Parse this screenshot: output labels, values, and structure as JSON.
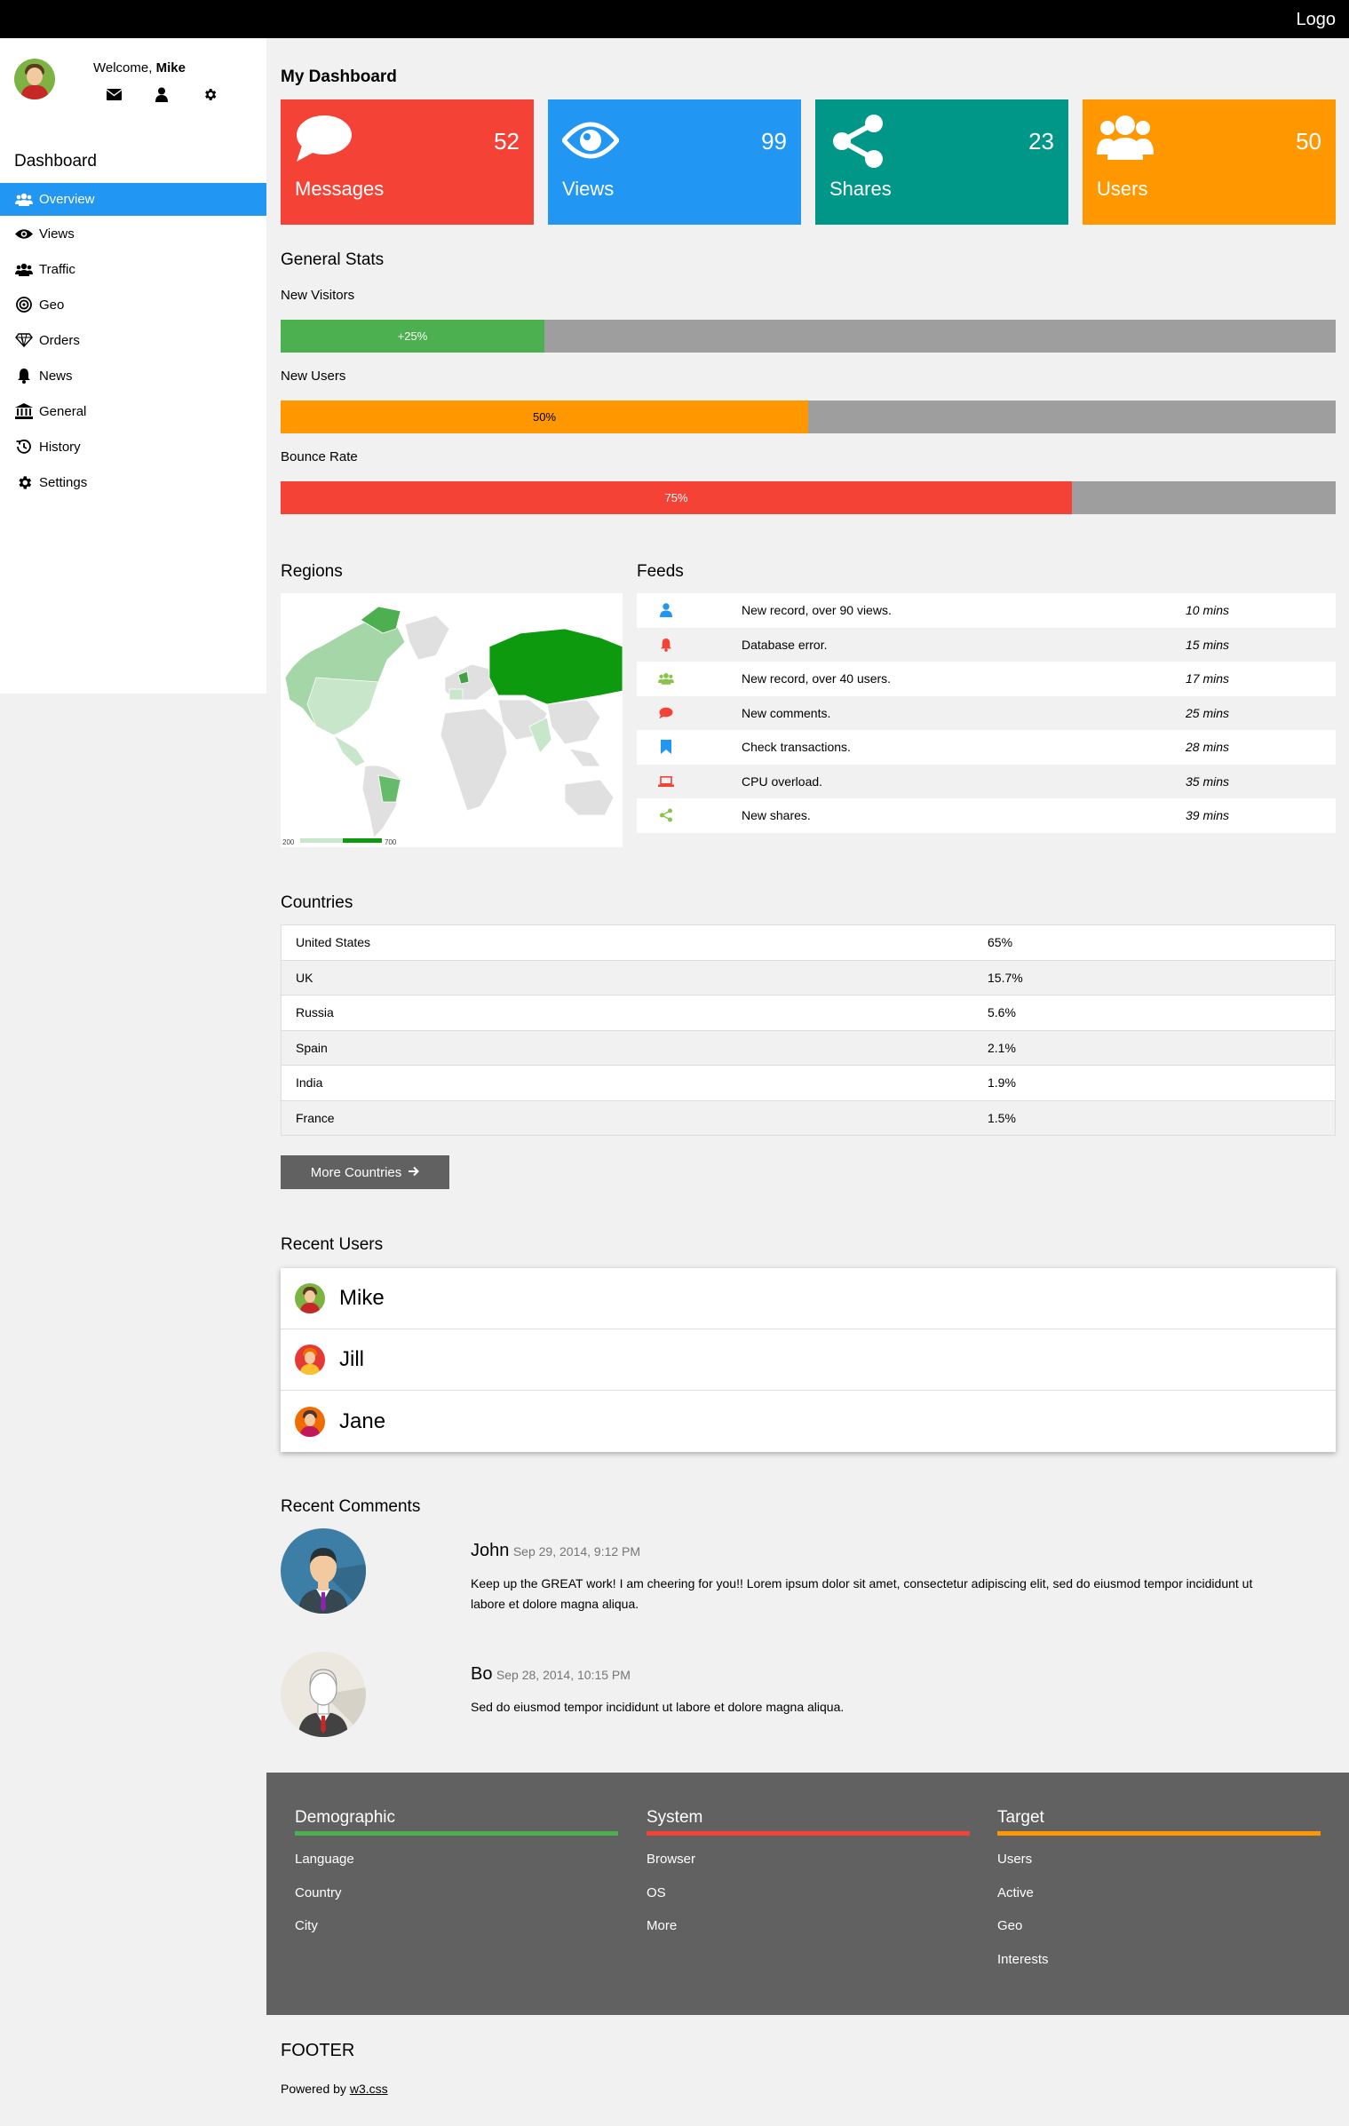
{
  "topbar": {
    "logo": "Logo"
  },
  "sidebar": {
    "welcome_prefix": "Welcome, ",
    "welcome_name": "Mike",
    "title": "Dashboard",
    "items": [
      {
        "label": "Overview",
        "icon": "users-icon",
        "active": true
      },
      {
        "label": "Views",
        "icon": "eye-icon"
      },
      {
        "label": "Traffic",
        "icon": "users-icon"
      },
      {
        "label": "Geo",
        "icon": "bullseye-icon"
      },
      {
        "label": "Orders",
        "icon": "diamond-icon"
      },
      {
        "label": "News",
        "icon": "bell-icon"
      },
      {
        "label": "General",
        "icon": "bank-icon"
      },
      {
        "label": "History",
        "icon": "history-icon"
      },
      {
        "label": "Settings",
        "icon": "cog-icon"
      }
    ]
  },
  "dashboard": {
    "title": "My Dashboard",
    "cards": [
      {
        "label": "Messages",
        "value": "52",
        "color": "#f44336",
        "icon": "comment-icon"
      },
      {
        "label": "Views",
        "value": "99",
        "color": "#2196f3",
        "icon": "eye-icon"
      },
      {
        "label": "Shares",
        "value": "23",
        "color": "#009688",
        "icon": "share-icon"
      },
      {
        "label": "Users",
        "value": "50",
        "color": "#ff9800",
        "icon": "users-icon"
      }
    ]
  },
  "stats": {
    "title": "General Stats",
    "items": [
      {
        "label": "New Visitors",
        "text": "+25%",
        "value": 25,
        "color": "#4caf50"
      },
      {
        "label": "New Users",
        "text": "50%",
        "value": 50,
        "color": "#ff9800"
      },
      {
        "label": "Bounce Rate",
        "text": "75%",
        "value": 75,
        "color": "#f44336"
      }
    ]
  },
  "regions": {
    "title": "Regions",
    "legend_min": "200",
    "legend_max": "700"
  },
  "feeds": {
    "title": "Feeds",
    "items": [
      {
        "text": "New record, over 90 views.",
        "time": "10 mins",
        "icon": "user-icon",
        "color": "#2196f3"
      },
      {
        "text": "Database error.",
        "time": "15 mins",
        "icon": "bell-icon",
        "color": "#f44336"
      },
      {
        "text": "New record, over 40 users.",
        "time": "17 mins",
        "icon": "users-icon",
        "color": "#8bc34a"
      },
      {
        "text": "New comments.",
        "time": "25 mins",
        "icon": "comment-icon",
        "color": "#f44336"
      },
      {
        "text": "Check transactions.",
        "time": "28 mins",
        "icon": "bookmark-icon",
        "color": "#2196f3"
      },
      {
        "text": "CPU overload.",
        "time": "35 mins",
        "icon": "laptop-icon",
        "color": "#f44336"
      },
      {
        "text": "New shares.",
        "time": "39 mins",
        "icon": "share-icon",
        "color": "#8bc34a"
      }
    ]
  },
  "countries": {
    "title": "Countries",
    "rows": [
      {
        "name": "United States",
        "value": "65%"
      },
      {
        "name": "UK",
        "value": "15.7%"
      },
      {
        "name": "Russia",
        "value": "5.6%"
      },
      {
        "name": "Spain",
        "value": "2.1%"
      },
      {
        "name": "India",
        "value": "1.9%"
      },
      {
        "name": "France",
        "value": "1.5%"
      }
    ],
    "more_label": "More Countries"
  },
  "recent_users": {
    "title": "Recent Users",
    "users": [
      {
        "name": "Mike",
        "bg": "#7cb342",
        "hair": "#5b3a1e",
        "shirt": "#c62828"
      },
      {
        "name": "Jill",
        "bg": "#e53935",
        "hair": "#ef6c00",
        "shirt": "#fbc02d"
      },
      {
        "name": "Jane",
        "bg": "#ef6c00",
        "hair": "#4e342e",
        "shirt": "#c2185b"
      }
    ]
  },
  "recent_comments": {
    "title": "Recent Comments",
    "comments": [
      {
        "name": "John",
        "date": "Sep 29, 2014, 9:12 PM",
        "text": "Keep up the GREAT work! I am cheering for you!! Lorem ipsum dolor sit amet, consectetur adipiscing elit, sed do eiusmod tempor incididunt ut labore et dolore magna aliqua."
      },
      {
        "name": "Bo",
        "date": "Sep 28, 2014, 10:15 PM",
        "text": "Sed do eiusmod tempor incididunt ut labore et dolore magna aliqua."
      }
    ]
  },
  "footer": {
    "columns": [
      {
        "title": "Demographic",
        "color": "#4caf50",
        "links": [
          "Language",
          "Country",
          "City"
        ]
      },
      {
        "title": "System",
        "color": "#f44336",
        "links": [
          "Browser",
          "OS",
          "More"
        ]
      },
      {
        "title": "Target",
        "color": "#ff9800",
        "links": [
          "Users",
          "Active",
          "Geo",
          "Interests"
        ]
      }
    ],
    "title": "FOOTER",
    "powered_prefix": "Powered by ",
    "powered_link": "w3.css"
  }
}
